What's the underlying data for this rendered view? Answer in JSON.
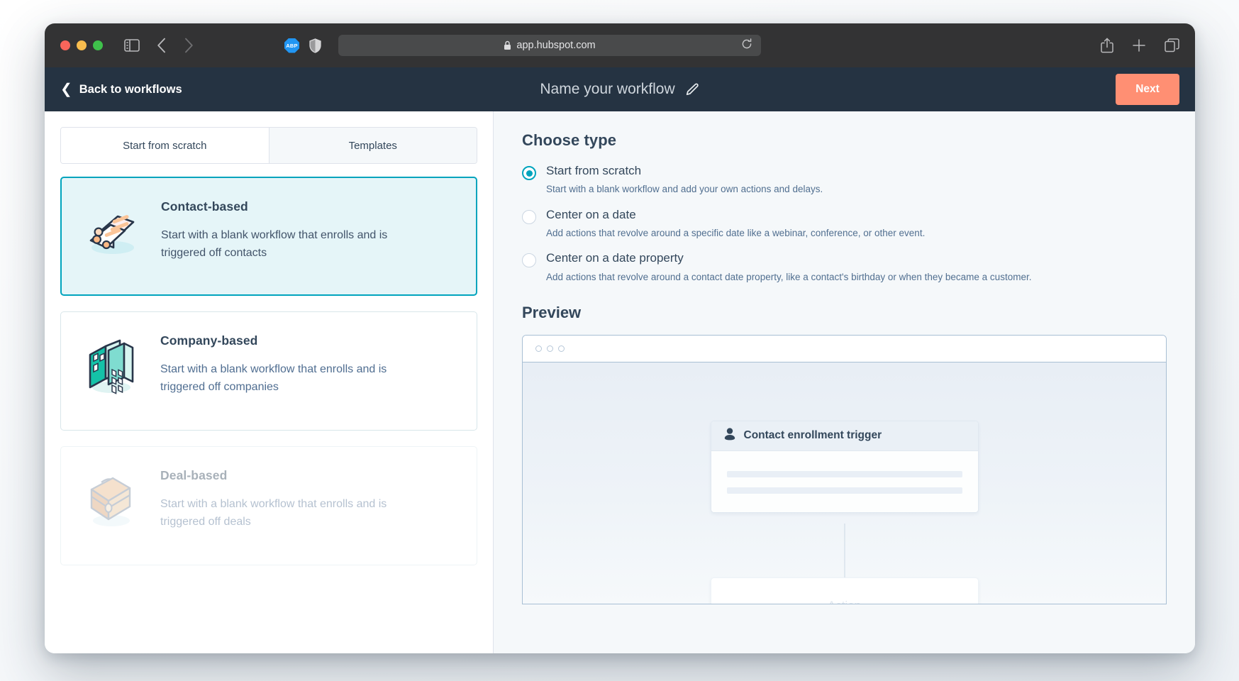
{
  "browser": {
    "url": "app.hubspot.com",
    "lock_icon": "lock-icon",
    "extension_label": "ABP",
    "reload_icon": "reload-icon",
    "share_icon": "share-icon",
    "new_tab_icon": "plus-icon",
    "tabs_icon": "tabs-overview-icon",
    "sidebar_icon": "sidebar-toggle-icon",
    "back_icon": "nav-back-icon",
    "forward_icon": "nav-forward-icon",
    "shield_icon": "shield-icon"
  },
  "appbar": {
    "back_label": "Back to workflows",
    "workflow_title": "Name your workflow",
    "edit_icon": "pencil-icon",
    "next_label": "Next",
    "next_color": "#ff8f73",
    "bar_color": "#253342"
  },
  "left_panel": {
    "tabs": [
      {
        "label": "Start from scratch",
        "active": true
      },
      {
        "label": "Templates",
        "active": false
      }
    ],
    "cards": [
      {
        "title": "Contact-based",
        "description": "Start with a blank workflow that enrolls and is triggered off contacts",
        "icon": "contact-list-icon",
        "selected": true
      },
      {
        "title": "Company-based",
        "description": "Start with a blank workflow that enrolls and is triggered off companies",
        "icon": "office-building-icon",
        "selected": false
      },
      {
        "title": "Deal-based",
        "description": "Start with a blank workflow that enrolls and is triggered off deals",
        "icon": "briefcase-icon",
        "selected": false
      }
    ],
    "selected_accent": "#00a4bd",
    "selected_fill": "#e5f5f8"
  },
  "right_panel": {
    "choose_type_heading": "Choose type",
    "options": [
      {
        "label": "Start from scratch",
        "description": "Start with a blank workflow and add your own actions and delays.",
        "checked": true
      },
      {
        "label": "Center on a date",
        "description": "Add actions that revolve around a specific date like a webinar, conference, or other event.",
        "checked": false
      },
      {
        "label": "Center on a date property",
        "description": "Add actions that revolve around a contact date property, like a contact's birthday or when they became a customer.",
        "checked": false
      }
    ],
    "preview_heading": "Preview",
    "preview": {
      "trigger_node_title": "Contact enrollment trigger",
      "trigger_icon": "contact-person-icon",
      "action_node_label": "Action"
    }
  }
}
